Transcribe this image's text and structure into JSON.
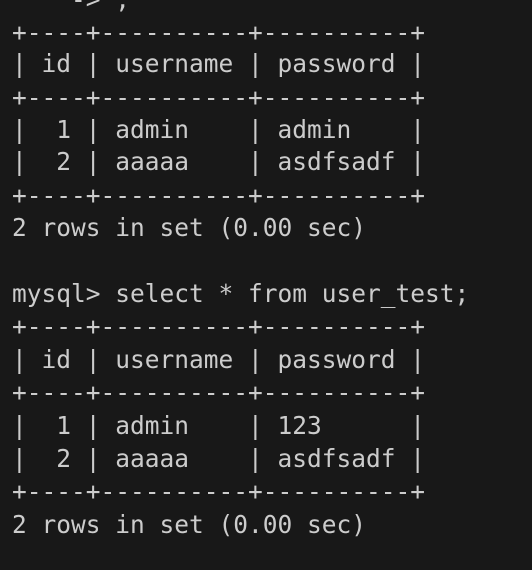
{
  "terminal": {
    "lines": [
      "    -> ;",
      "+----+----------+----------+",
      "| id | username | password |",
      "+----+----------+----------+",
      "|  1 | admin    | admin    |",
      "|  2 | aaaaa    | asdfsadf |",
      "+----+----------+----------+",
      "2 rows in set (0.00 sec)",
      "",
      "mysql> select * from user_test;",
      "+----+----------+----------+",
      "| id | username | password |",
      "+----+----------+----------+",
      "|  1 | admin    | 123      |",
      "|  2 | aaaaa    | asdfsadf |",
      "+----+----------+----------+",
      "2 rows in set (0.00 sec)"
    ]
  }
}
